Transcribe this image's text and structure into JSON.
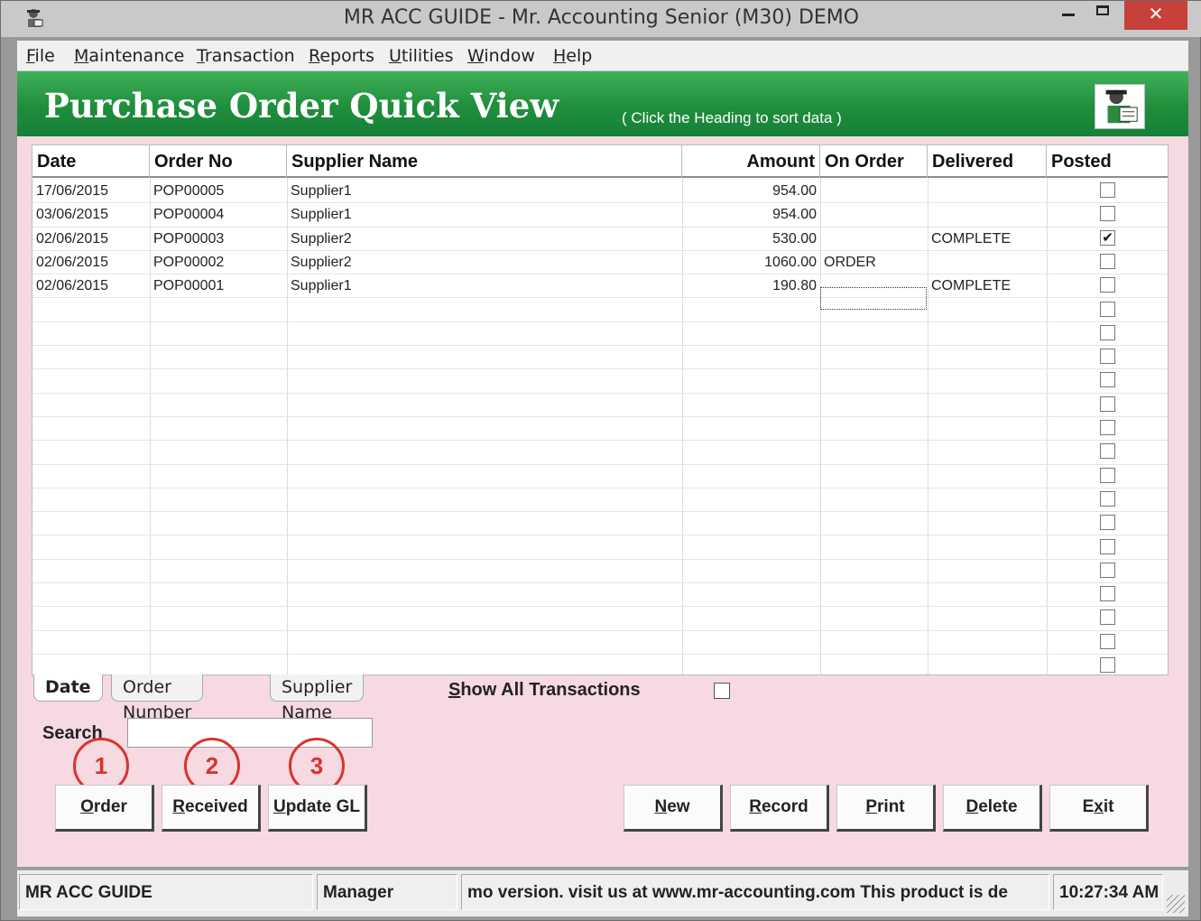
{
  "window": {
    "title": "MR ACC GUIDE - Mr. Accounting Senior (M30) DEMO",
    "close_glyph": "✕"
  },
  "menu": [
    {
      "hot": "F",
      "rest": "ile"
    },
    {
      "hot": "M",
      "rest": "aintenance"
    },
    {
      "hot": "T",
      "rest": "ransaction"
    },
    {
      "hot": "R",
      "rest": "eports"
    },
    {
      "hot": "U",
      "rest": "tilities"
    },
    {
      "hot": "W",
      "rest": "indow"
    },
    {
      "hot": "H",
      "rest": "elp"
    }
  ],
  "header": {
    "title": "Purchase Order Quick View",
    "hint": "( Click the Heading to sort data )"
  },
  "grid": {
    "columns": [
      "Date",
      "Order No",
      "Supplier Name",
      "Amount",
      "On Order",
      "Delivered",
      "Posted"
    ],
    "rows": [
      {
        "date": "17/06/2015",
        "order_no": "POP00005",
        "supplier": "Supplier1",
        "amount": "954.00",
        "on_order": "",
        "delivered": "",
        "posted": false
      },
      {
        "date": "03/06/2015",
        "order_no": "POP00004",
        "supplier": "Supplier1",
        "amount": "954.00",
        "on_order": "",
        "delivered": "",
        "posted": false
      },
      {
        "date": "02/06/2015",
        "order_no": "POP00003",
        "supplier": "Supplier2",
        "amount": "530.00",
        "on_order": "",
        "delivered": "COMPLETE",
        "posted": true
      },
      {
        "date": "02/06/2015",
        "order_no": "POP00002",
        "supplier": "Supplier2",
        "amount": "1060.00",
        "on_order": "ORDER",
        "delivered": "",
        "posted": false
      },
      {
        "date": "02/06/2015",
        "order_no": "POP00001",
        "supplier": "Supplier1",
        "amount": "190.80",
        "on_order": "",
        "delivered": "COMPLETE",
        "posted": false
      }
    ],
    "empty_rows": 16,
    "check_glyph": "✔"
  },
  "sort_tabs": [
    "Date",
    "Order Number",
    "Supplier Name"
  ],
  "show_all": {
    "hot": "S",
    "rest": "how All Transactions",
    "checked": false
  },
  "search": {
    "label": "Search",
    "value": ""
  },
  "callouts": [
    "1",
    "2",
    "3"
  ],
  "left_buttons": [
    {
      "hot": "O",
      "rest": "rder"
    },
    {
      "hot": "R",
      "rest": "eceived"
    },
    {
      "hot": "U",
      "rest": "pdate GL"
    }
  ],
  "right_buttons": [
    {
      "pre": "",
      "hot": "N",
      "rest": "ew"
    },
    {
      "pre": "",
      "hot": "R",
      "rest": "ecord"
    },
    {
      "pre": "",
      "hot": "P",
      "rest": "rint"
    },
    {
      "pre": "",
      "hot": "D",
      "rest": "elete"
    },
    {
      "pre": "E",
      "hot": "x",
      "rest": "it"
    }
  ],
  "status": {
    "company": "MR ACC GUIDE",
    "user": "Manager",
    "message": "mo version.  visit us at www.mr-accounting.com This product is de",
    "time": "10:27:34 AM"
  },
  "colors": {
    "header_green": "#1f8e3b",
    "content_pink": "#f6d9e1",
    "callout_red": "#d8332e",
    "close_red": "#c7403a"
  }
}
